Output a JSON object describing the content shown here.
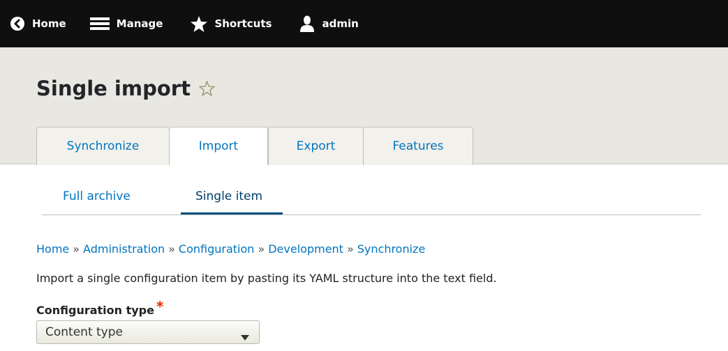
{
  "toolbar": {
    "home_label": "Home",
    "manage_label": "Manage",
    "shortcuts_label": "Shortcuts",
    "user_label": "admin"
  },
  "page": {
    "title": "Single import"
  },
  "primary_tabs": [
    {
      "label": "Synchronize",
      "active": false
    },
    {
      "label": "Import",
      "active": true
    },
    {
      "label": "Export",
      "active": false
    },
    {
      "label": "Features",
      "active": false
    }
  ],
  "secondary_tabs": [
    {
      "label": "Full archive",
      "active": false
    },
    {
      "label": "Single item",
      "active": true
    }
  ],
  "breadcrumb": {
    "items": [
      "Home",
      "Administration",
      "Configuration",
      "Development",
      "Synchronize"
    ],
    "separator": "»"
  },
  "description": "Import a single configuration item by pasting its YAML structure into the text field.",
  "form": {
    "config_type_label": "Configuration type",
    "required_marker": "*",
    "config_type_value": "Content type"
  },
  "icons": {
    "home": "chevron-left-circle-icon",
    "manage": "hamburger-menu-icon",
    "shortcuts": "star-icon",
    "user": "user-icon",
    "title_star": "star-outline-icon",
    "select_caret": "caret-down-icon"
  },
  "colors": {
    "toolbar_bg": "#0f0f0f",
    "header_bg": "#e8e7e1",
    "link": "#0074bd",
    "required": "#e62600",
    "active_underline": "#004f80"
  }
}
